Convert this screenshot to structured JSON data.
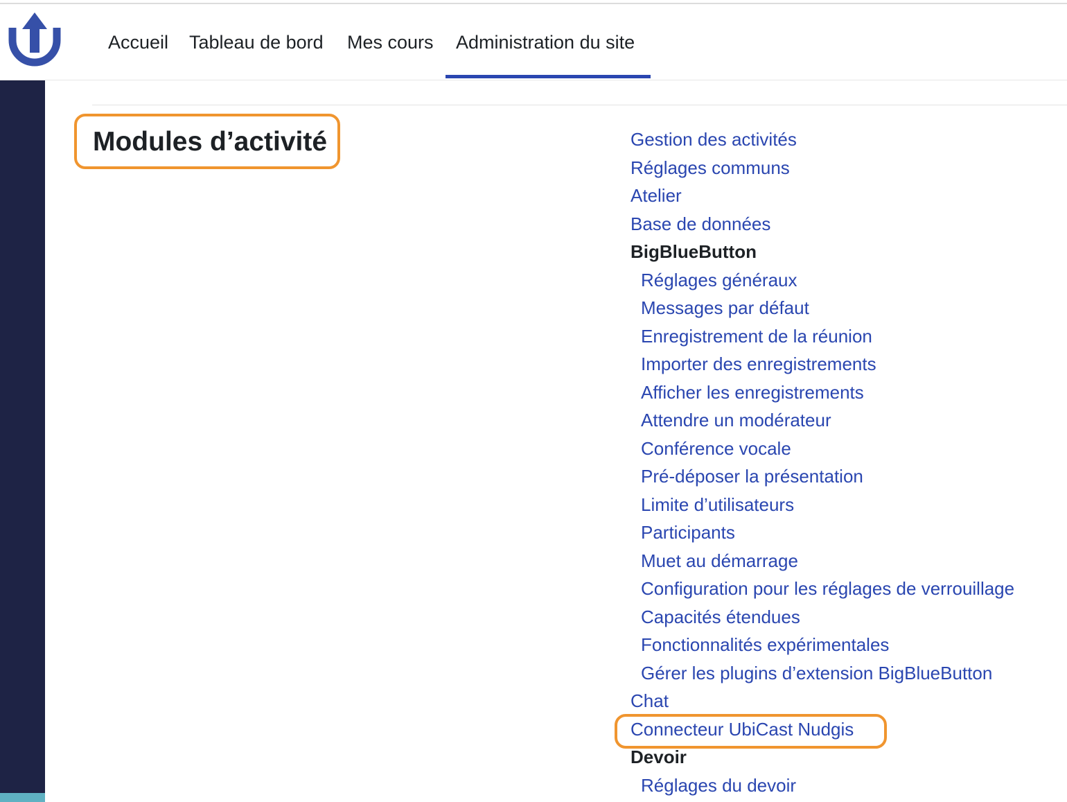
{
  "navbar": {
    "logo_icon": "u-arrow-up-logo-icon",
    "items": [
      {
        "label": "Accueil",
        "active": false
      },
      {
        "label": "Tableau de bord",
        "active": false
      },
      {
        "label": "Mes cours",
        "active": false
      },
      {
        "label": "Administration du site",
        "active": true
      }
    ]
  },
  "page": {
    "title": "Modules d’activité"
  },
  "links": [
    {
      "label": "Gestion des activités",
      "level": 1,
      "type": "link"
    },
    {
      "label": "Réglages communs",
      "level": 1,
      "type": "link"
    },
    {
      "label": "Atelier",
      "level": 1,
      "type": "link"
    },
    {
      "label": "Base de données",
      "level": 1,
      "type": "link"
    },
    {
      "label": "BigBlueButton",
      "level": 1,
      "type": "heading"
    },
    {
      "label": "Réglages généraux",
      "level": 2,
      "type": "link"
    },
    {
      "label": "Messages par défaut",
      "level": 2,
      "type": "link"
    },
    {
      "label": "Enregistrement de la réunion",
      "level": 2,
      "type": "link"
    },
    {
      "label": "Importer des enregistrements",
      "level": 2,
      "type": "link"
    },
    {
      "label": "Afficher les enregistrements",
      "level": 2,
      "type": "link"
    },
    {
      "label": "Attendre un modérateur",
      "level": 2,
      "type": "link"
    },
    {
      "label": "Conférence vocale",
      "level": 2,
      "type": "link"
    },
    {
      "label": "Pré-déposer la présentation",
      "level": 2,
      "type": "link"
    },
    {
      "label": "Limite d’utilisateurs",
      "level": 2,
      "type": "link"
    },
    {
      "label": "Participants",
      "level": 2,
      "type": "link"
    },
    {
      "label": "Muet au démarrage",
      "level": 2,
      "type": "link"
    },
    {
      "label": "Configuration pour les réglages de verrouillage",
      "level": 2,
      "type": "link"
    },
    {
      "label": "Capacités étendues",
      "level": 2,
      "type": "link"
    },
    {
      "label": "Fonctionnalités expérimentales",
      "level": 2,
      "type": "link"
    },
    {
      "label": "Gérer les plugins d’extension BigBlueButton",
      "level": 2,
      "type": "link"
    },
    {
      "label": "Chat",
      "level": 1,
      "type": "link"
    },
    {
      "label": "Connecteur UbiCast Nudgis",
      "level": 1,
      "type": "link"
    },
    {
      "label": "Devoir",
      "level": 1,
      "type": "heading"
    },
    {
      "label": "Réglages du devoir",
      "level": 2,
      "type": "link"
    }
  ],
  "colors": {
    "link": "#2a46b0",
    "highlight": "#f0952f",
    "sidebar": "#1e2345",
    "text": "#1d2125"
  }
}
